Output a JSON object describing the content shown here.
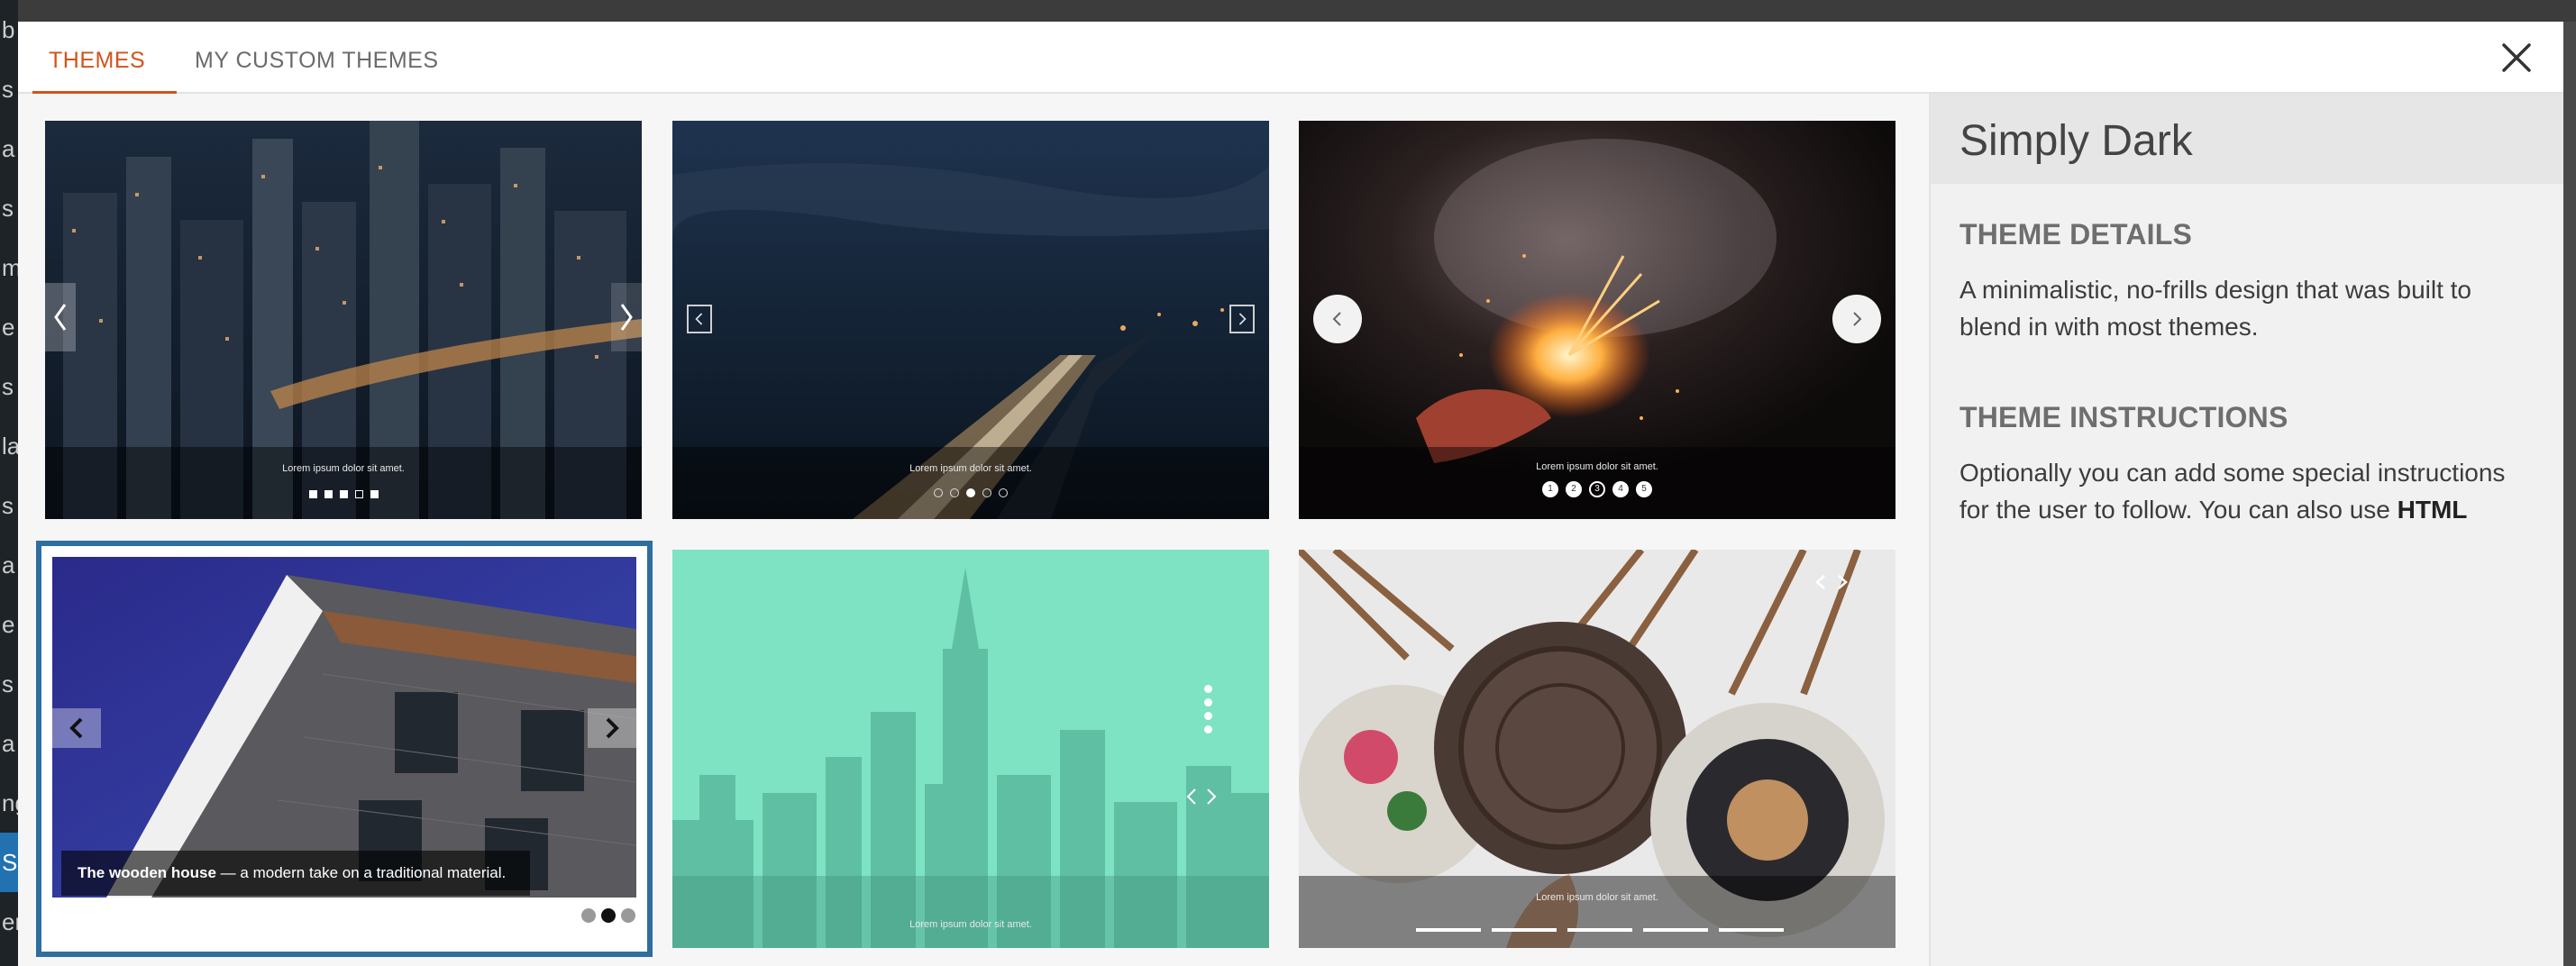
{
  "tabs": [
    {
      "label": "THEMES",
      "active": true
    },
    {
      "label": "MY CUSTOM THEMES",
      "active": false
    }
  ],
  "accent_color": "#d0541c",
  "selected_border_color": "#2f6f9f",
  "themes": [
    {
      "caption": "Lorem ipsum dolor sit amet."
    },
    {
      "caption": "Lorem ipsum dolor sit amet."
    },
    {
      "caption": "Lorem ipsum dolor sit amet.",
      "dots": [
        "1",
        "2",
        "3",
        "4",
        "5"
      ]
    },
    {
      "caption_bold": "The wooden house",
      "caption_rest": " — a modern take on a traditional material."
    },
    {
      "caption": "Lorem ipsum dolor sit amet."
    },
    {
      "caption": "Lorem ipsum dolor sit amet."
    }
  ],
  "selected_theme": 4,
  "panel": {
    "title": "Simply Dark",
    "details_heading": "THEME DETAILS",
    "details_text": "A minimalistic, no-frills design that was built to blend in with most themes.",
    "instructions_heading": "THEME INSTRUCTIONS",
    "instructions_text": "Optionally you can add some special instructions for the user to follow. You can also use ",
    "instructions_bold": "HTML"
  },
  "icons": {
    "close": "close-icon",
    "prev": "chevron-left-icon",
    "next": "chevron-right-icon"
  }
}
